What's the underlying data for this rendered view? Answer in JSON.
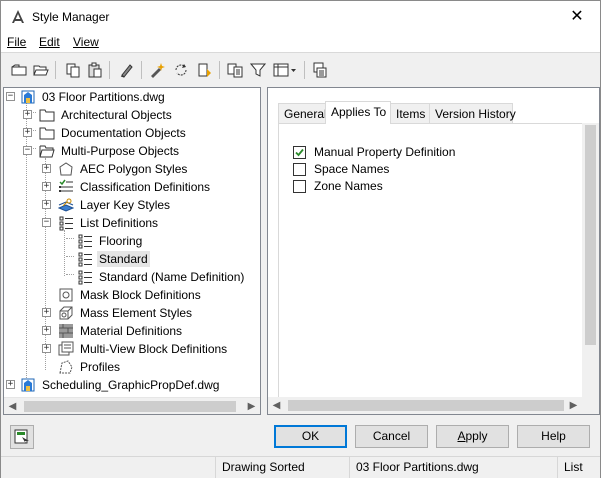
{
  "window": {
    "title": "Style Manager",
    "close_glyph": "✕"
  },
  "menu": {
    "file": "File",
    "edit": "Edit",
    "view": "View"
  },
  "toolbar": {
    "icons": [
      "new-icon",
      "open-icon",
      "copy-icon",
      "paste-icon",
      "purge-icon",
      "edit-style-icon",
      "synchronize-icon",
      "update-icon",
      "toggle-view-icon",
      "filter-icon",
      "view-options-icon",
      "inbox-icon"
    ]
  },
  "tree": {
    "items": [
      {
        "label": "03 Floor Partitions.dwg"
      },
      {
        "label": "Architectural Objects"
      },
      {
        "label": "Documentation Objects"
      },
      {
        "label": "Multi-Purpose Objects"
      },
      {
        "label": "AEC Polygon Styles"
      },
      {
        "label": "Classification Definitions"
      },
      {
        "label": "Layer Key Styles"
      },
      {
        "label": "List Definitions"
      },
      {
        "label": "Flooring"
      },
      {
        "label": "Standard"
      },
      {
        "label": "Standard (Name Definition)"
      },
      {
        "label": "Mask Block Definitions"
      },
      {
        "label": "Mass Element Styles"
      },
      {
        "label": "Material Definitions"
      },
      {
        "label": "Multi-View Block Definitions"
      },
      {
        "label": "Profiles"
      },
      {
        "label": "Scheduling_GraphicPropDef.dwg"
      }
    ]
  },
  "tabs": [
    "General",
    "Applies To",
    "Items",
    "Version History"
  ],
  "applies_to": [
    {
      "label": "Manual Property Definition",
      "checked": true
    },
    {
      "label": "Space Names",
      "checked": false
    },
    {
      "label": "Zone Names",
      "checked": false
    }
  ],
  "buttons": {
    "ok": "OK",
    "cancel": "Cancel",
    "apply_pre": "",
    "apply_u": "A",
    "apply_post": "pply",
    "help": "Help"
  },
  "status": {
    "sort": "Drawing Sorted",
    "file": "03 Floor Partitions.dwg",
    "view": "List"
  },
  "colors": {
    "accent": "#0078d7",
    "check": "#2a8a2a"
  }
}
